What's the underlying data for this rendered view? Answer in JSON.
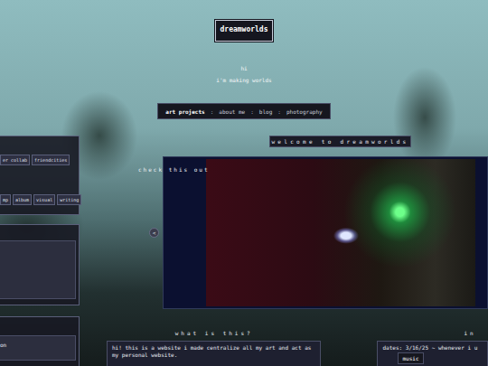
{
  "site": {
    "title": "dreamworlds",
    "greeting": "hi",
    "tagline": "i'm making worlds"
  },
  "nav": {
    "separator": ":",
    "items": [
      {
        "label": "art projects",
        "selected": true
      },
      {
        "label": "about me",
        "selected": false
      },
      {
        "label": "blog",
        "selected": false
      },
      {
        "label": "photography",
        "selected": false
      }
    ]
  },
  "banner": "welcome to dreamworlds",
  "sidebar": {
    "panels": [
      {
        "kind": "tags",
        "rows": [
          [
            "er collab",
            "friendcities"
          ],
          [
            "mp",
            "album",
            "visual",
            "writing"
          ]
        ]
      },
      {
        "kind": "empty"
      },
      {
        "kind": "box",
        "text": "on"
      }
    ]
  },
  "featured": {
    "label": "check this out",
    "prev": "<"
  },
  "about": {
    "heading": "what is this?",
    "text": "hi! this is a website i made centralize all my art and act as my personal website."
  },
  "info": {
    "heading": "in",
    "text": "dates: 3/16/25 ~ whenever i u"
  },
  "music": {
    "label": "music"
  }
}
